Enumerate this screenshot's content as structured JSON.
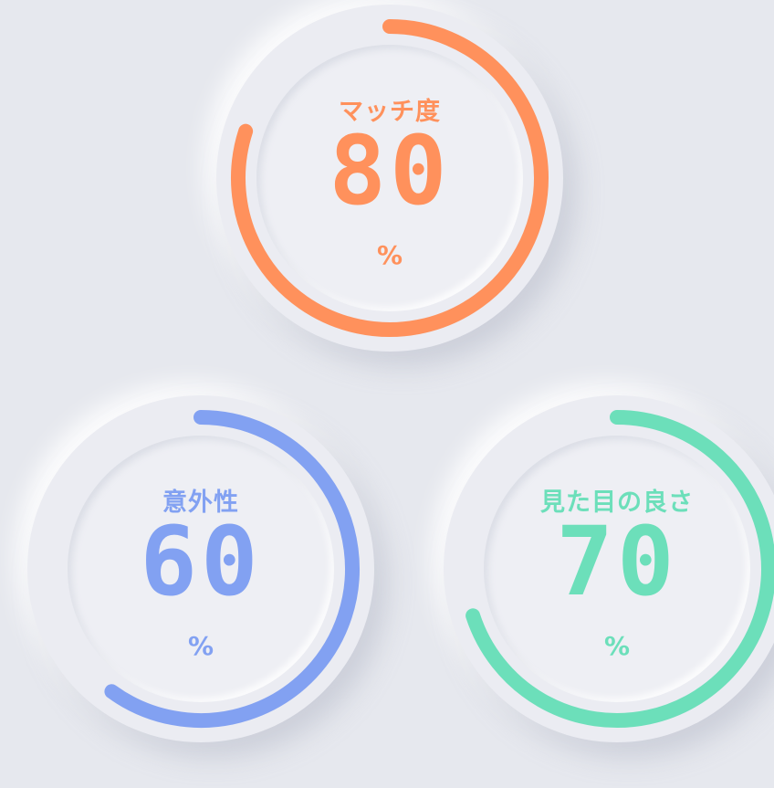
{
  "gauges": [
    {
      "id": "match",
      "label": "マッチ度",
      "value": "80",
      "unit": "%",
      "percent": 80,
      "color": "#ff915c"
    },
    {
      "id": "surprise",
      "label": "意外性",
      "value": "60",
      "unit": "%",
      "percent": 60,
      "color": "#82a1f2"
    },
    {
      "id": "looks",
      "label": "見た目の良さ",
      "value": "70",
      "unit": "%",
      "percent": 70,
      "color": "#6cdfba"
    }
  ]
}
